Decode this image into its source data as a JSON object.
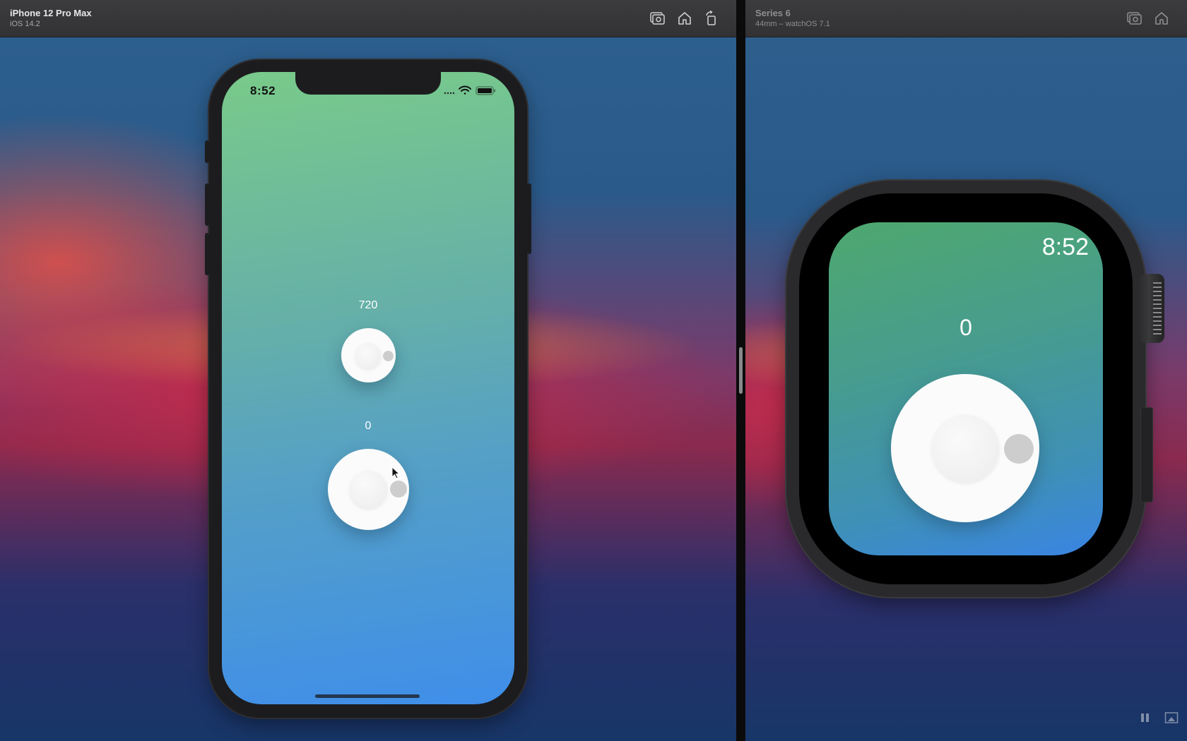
{
  "left_window": {
    "title": "iPhone 12 Pro Max",
    "subtitle": "iOS 14.2",
    "toolbar_icons": [
      "screenshot-icon",
      "home-icon",
      "rotate-icon"
    ]
  },
  "right_window": {
    "title": "Series 6",
    "subtitle": "44mm – watchOS 7.1",
    "toolbar_icons": [
      "screenshot-icon",
      "home-icon"
    ]
  },
  "iphone": {
    "status_time": "8:52",
    "knob_top": {
      "value": "720"
    },
    "knob_bottom": {
      "value": "0"
    }
  },
  "watch": {
    "status_time": "8:52",
    "knob": {
      "value": "0"
    }
  },
  "bottom_controls": [
    "pause-icon",
    "picture-in-picture-icon"
  ]
}
